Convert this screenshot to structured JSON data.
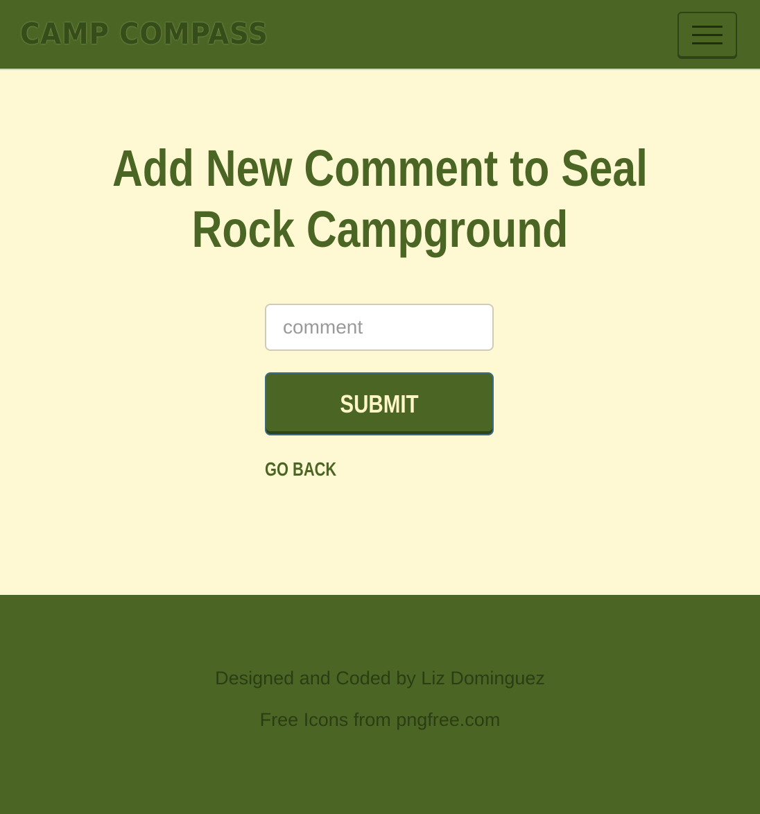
{
  "navbar": {
    "brand": "CAMP COMPASS",
    "menu_icon": "hamburger-menu-icon"
  },
  "main": {
    "title": "Add New Comment to Seal Rock Campground",
    "comment_field": {
      "placeholder": "comment",
      "value": ""
    },
    "submit_label": "SUBMIT",
    "go_back_label": "GO BACK"
  },
  "footer": {
    "credit": "Designed and Coded by Liz Dominguez",
    "icons_credit": "Free Icons from pngfree.com"
  },
  "colors": {
    "primary_green": "#4b6624",
    "background_cream": "#fff9d3",
    "footer_text": "#2a3d14",
    "button_text": "#fff6c8"
  }
}
